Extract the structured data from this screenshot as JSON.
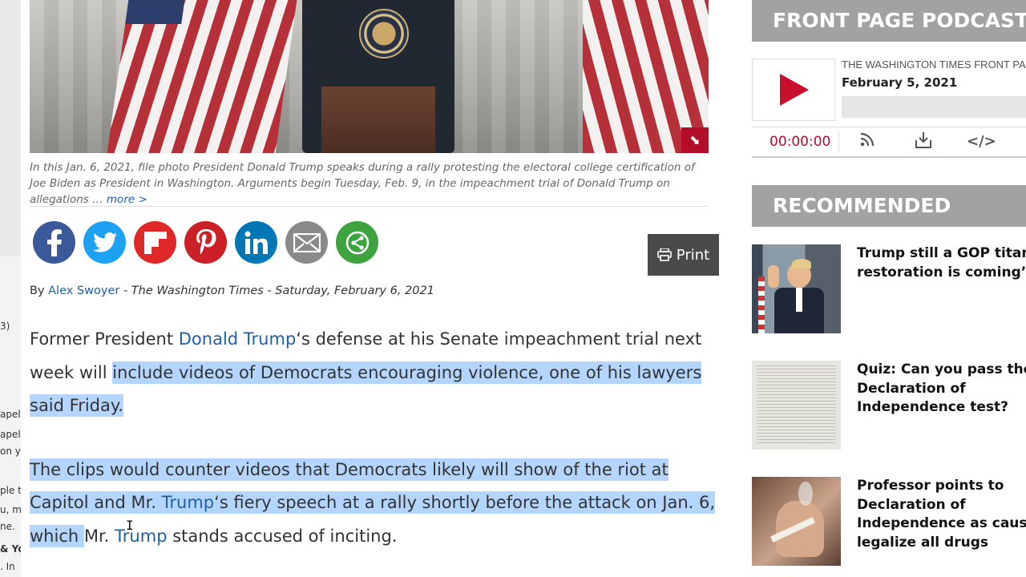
{
  "background_window": {
    "lines": [
      "3)",
      "apel",
      "apel",
      "on y",
      "ple t",
      "u, m",
      "ne.",
      "& Yo",
      ". In"
    ]
  },
  "hero": {
    "expand_icon": "expand-arrow-icon"
  },
  "caption": {
    "text": "In this Jan. 6, 2021, file photo President Donald Trump speaks during a rally protesting the electoral college certification of Joe Biden as President in Washington. Arguments begin Tuesday, Feb. 9, in the impeachment trial of Donald Trump on allegations …",
    "more": "more >"
  },
  "share": {
    "buttons": [
      {
        "name": "facebook",
        "color": "#3b5998"
      },
      {
        "name": "twitter",
        "color": "#1da1f2"
      },
      {
        "name": "flipboard",
        "color": "#e12828"
      },
      {
        "name": "pinterest",
        "color": "#cb2027"
      },
      {
        "name": "linkedin",
        "color": "#0077b5"
      },
      {
        "name": "email",
        "color": "#8a8a8a"
      },
      {
        "name": "more",
        "color": "#3ea33e"
      }
    ]
  },
  "print": {
    "label": "Print"
  },
  "byline": {
    "by": "By",
    "author": "Alex Swoyer",
    "dash1": " - ",
    "publication": "The Washington Times",
    "dash2": " - ",
    "date": "Saturday, February 6, 2021"
  },
  "article": {
    "p1": {
      "a": "Former President ",
      "link": "Donald Trump",
      "b": "‘s defense at his Senate impeachment trial next week will ",
      "c": "include videos of Democrats encouraging violence, one of his lawyers said Friday."
    },
    "p2": {
      "a": "The clips would counter videos that Democrats likely will show of the riot at Capitol and Mr. ",
      "link1": "Trump",
      "b": "‘s fiery speech at a rally shortly before the attack on Jan. 6, which ",
      "c": "Mr. ",
      "link2": "Trump",
      "d": " stands accused of inciting."
    }
  },
  "sidebar": {
    "podcast_header": "FRONT PAGE PODCAST",
    "player": {
      "series": "THE WASHINGTON TIMES FRONT PAGE",
      "episode_date": "February 5, 2021",
      "time": "00:00:00",
      "accent": "#b30d2a"
    },
    "recommended_header": "RECOMMENDED",
    "recommended": [
      {
        "title_l1": "Trump still a GOP titan",
        "title_l2": "restoration is coming’"
      },
      {
        "title_l1": "Quiz: Can you pass the",
        "title_l2": "Declaration of",
        "title_l3": "Independence test?"
      },
      {
        "title_l1": "Professor points to",
        "title_l2": "Declaration of",
        "title_l3": "Independence as caus",
        "title_l4": "legalize all drugs"
      }
    ]
  }
}
